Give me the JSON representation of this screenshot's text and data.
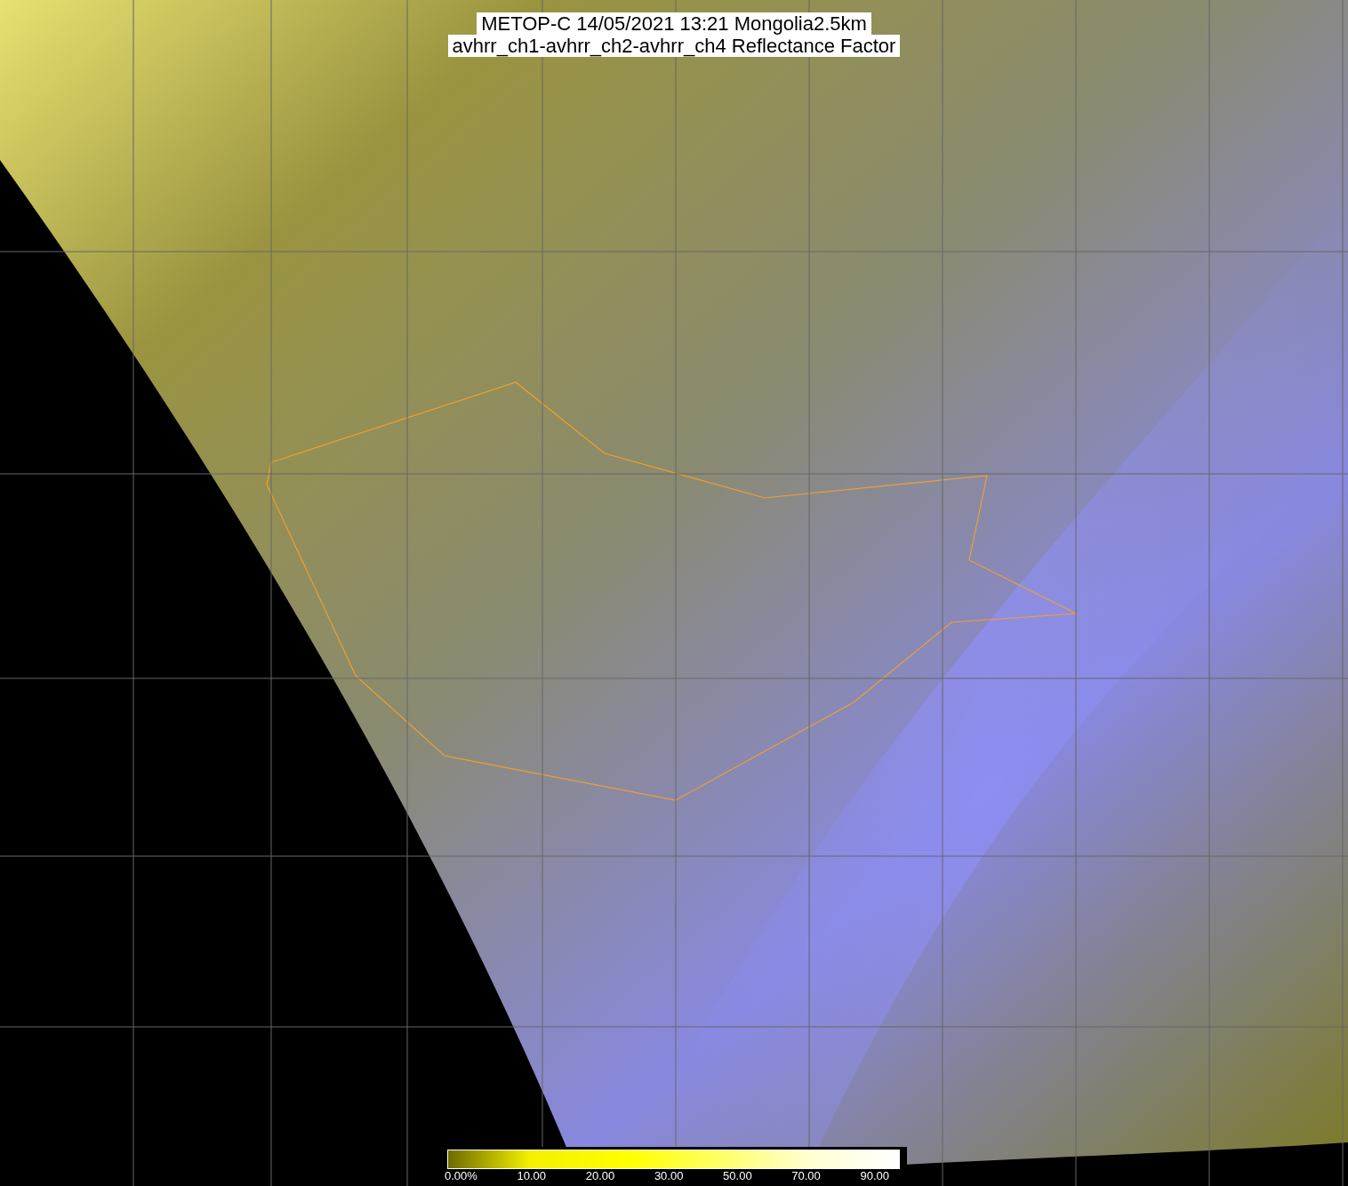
{
  "title": {
    "lines": [
      "METOP-C 14/05/2021 13:21 Mongolia2.5km",
      "avhrr_ch1-avhrr_ch2-avhrr_ch4 Reflectance Factor"
    ]
  },
  "colorbar": {
    "labels": [
      "0.00%",
      "10.00",
      "20.00",
      "30.00",
      "50.00",
      "70.00",
      "90.00"
    ]
  }
}
